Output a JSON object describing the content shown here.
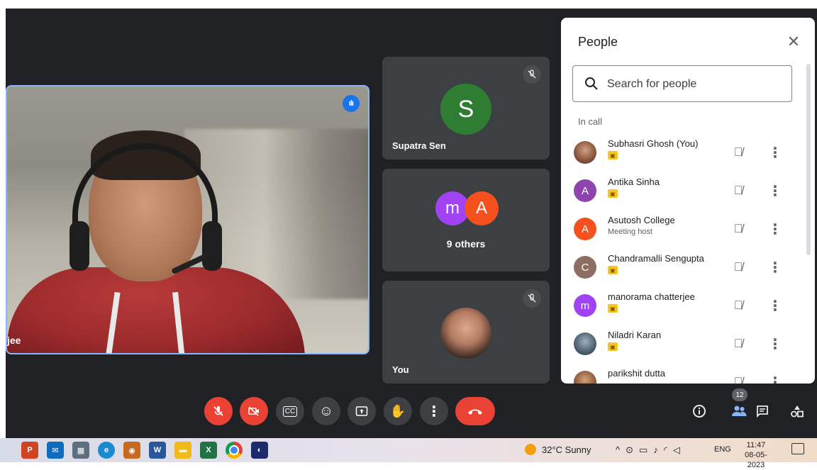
{
  "main_tile": {
    "name": "jee",
    "speaking_icon": "audio-wave-icon"
  },
  "tiles": [
    {
      "name": "Supatra Sen",
      "initial": "S",
      "color": "#2e7d32",
      "muted_icon": "mic-off-icon"
    },
    {
      "label": "9 others",
      "avatars": [
        {
          "initial": "m",
          "color": "#a142f4"
        },
        {
          "initial": "A",
          "color": "#f4511e"
        }
      ]
    },
    {
      "name": "You",
      "muted_icon": "mic-off-icon"
    }
  ],
  "panel": {
    "title": "People",
    "close_icon": "close-icon",
    "search_placeholder": "Search for people",
    "section": "In call",
    "people": [
      {
        "name": "Subhasri Ghosh (You)",
        "avatar": "photo",
        "color": "#8d6e63",
        "sub": ""
      },
      {
        "name": "Antika Sinha",
        "avatar": "A",
        "color": "#8e44ad",
        "sub": ""
      },
      {
        "name": "Asutosh College",
        "avatar": "A",
        "color": "#f4511e",
        "sub": "Meeting host"
      },
      {
        "name": "Chandramalli Sengupta",
        "avatar": "C",
        "color": "#8d6e63",
        "sub": ""
      },
      {
        "name": "manorama chatterjee",
        "avatar": "m",
        "color": "#a142f4",
        "sub": ""
      },
      {
        "name": "Niladri Karan",
        "avatar": "photo",
        "color": "#5d6d7e",
        "sub": ""
      },
      {
        "name": "parikshit dutta",
        "avatar": "photo",
        "color": "#a0522d",
        "sub": ""
      }
    ]
  },
  "controls": {
    "mic": "mic-off-icon",
    "camera": "camera-off-icon",
    "captions": "CC",
    "emoji": "☺",
    "present": "present-icon",
    "hand": "raise-hand-icon",
    "more": "more-vert-icon",
    "end": "end-call-icon",
    "participant_count": "12"
  },
  "taskbar": {
    "weather": "32°C Sunny",
    "language": "ENG",
    "time": "11:47",
    "date": "08-05-2023"
  }
}
